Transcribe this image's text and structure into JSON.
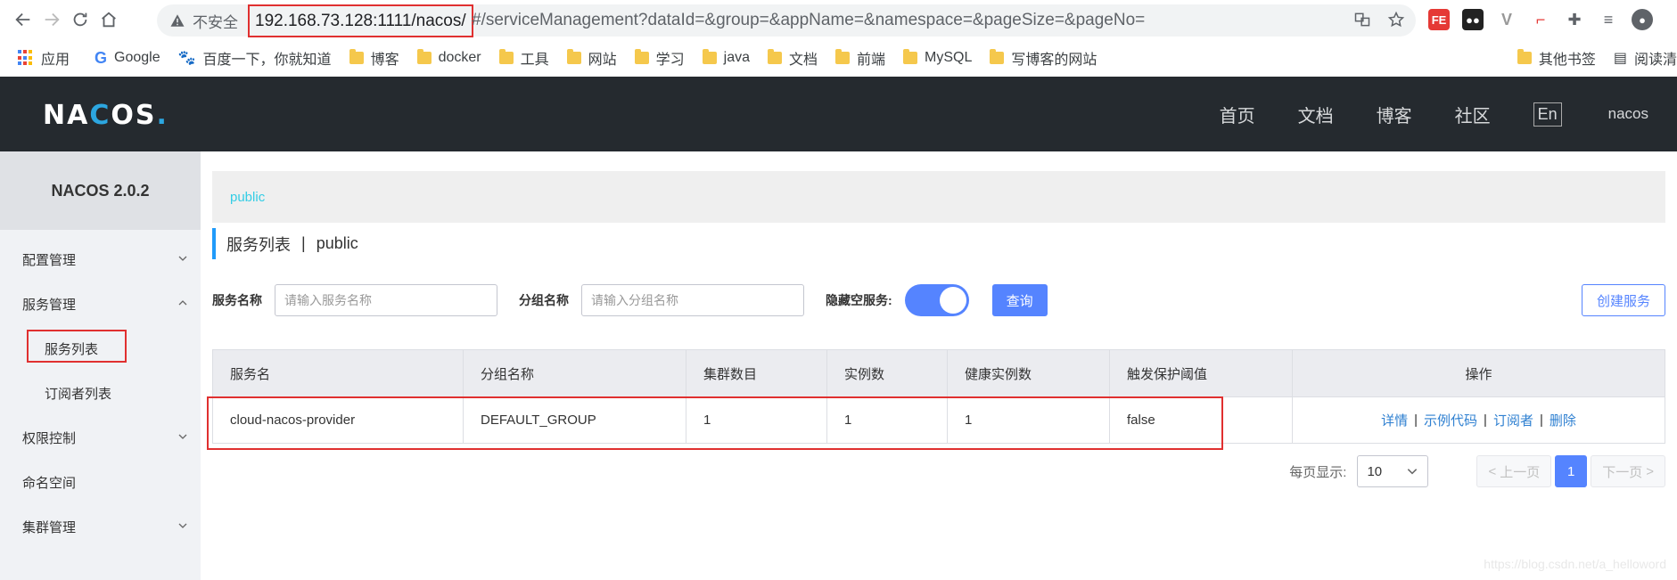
{
  "browser": {
    "insecure_label": "不安全",
    "url_host": "192.168.73.128:1111/nacos/",
    "url_rest": "#/serviceManagement?dataId=&group=&appName=&namespace=&pageSize=&pageNo="
  },
  "bookmarks": {
    "apps": "应用",
    "google": "Google",
    "baidu": "百度一下，你就知道",
    "items": [
      "博客",
      "docker",
      "工具",
      "网站",
      "学习",
      "java",
      "文档",
      "前端",
      "MySQL",
      "写博客的网站"
    ],
    "other": "其他书签",
    "reading": "阅读清"
  },
  "header": {
    "nav": [
      "首页",
      "文档",
      "博客",
      "社区"
    ],
    "lang": "En",
    "user": "nacos"
  },
  "sidebar": {
    "title": "NACOS 2.0.2",
    "config": "配置管理",
    "service": "服务管理",
    "service_list": "服务列表",
    "subscriber_list": "订阅者列表",
    "auth": "权限控制",
    "namespace": "命名空间",
    "cluster": "集群管理"
  },
  "main": {
    "namespace": "public",
    "title": "服务列表",
    "title_sep": "|",
    "title_ns": "public",
    "filters": {
      "service_label": "服务名称",
      "service_placeholder": "请输入服务名称",
      "group_label": "分组名称",
      "group_placeholder": "请输入分组名称",
      "hide_empty_label": "隐藏空服务:",
      "query": "查询",
      "create": "创建服务"
    },
    "table": {
      "headers": [
        "服务名",
        "分组名称",
        "集群数目",
        "实例数",
        "健康实例数",
        "触发保护阈值",
        "操作"
      ],
      "rows": [
        {
          "name": "cloud-nacos-provider",
          "group": "DEFAULT_GROUP",
          "clusters": "1",
          "instances": "1",
          "healthy": "1",
          "threshold": "false",
          "ops": [
            "详情",
            "示例代码",
            "订阅者",
            "删除"
          ]
        }
      ]
    },
    "pager": {
      "per_page_label": "每页显示:",
      "page_size": "10",
      "prev": "上一页",
      "current": "1",
      "next": "下一页"
    }
  },
  "watermark": "https://blog.csdn.net/a_helloword"
}
